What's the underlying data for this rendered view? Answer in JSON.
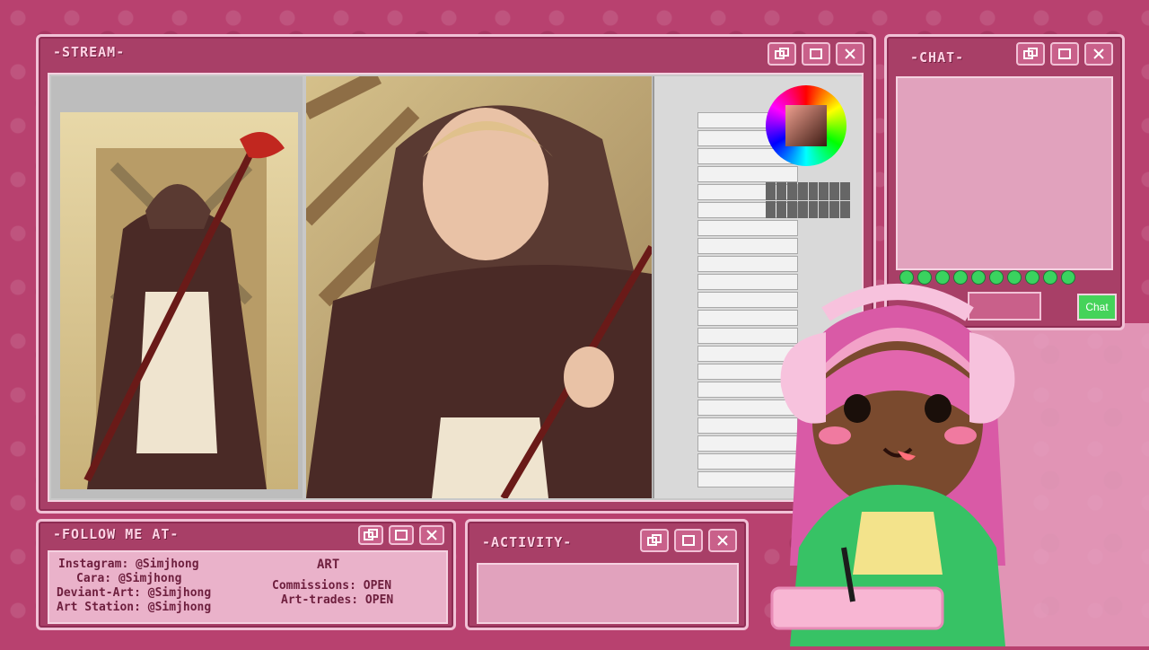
{
  "stream_window": {
    "title": "-STREAM-"
  },
  "chat_window": {
    "title": "-CHAT-",
    "send_label": "Chat"
  },
  "follow_window": {
    "title": "-FOLLOW ME AT-",
    "art_heading": "ART",
    "socials": [
      "Instagram: @Simjhong",
      "Cara: @Simjhong",
      "Deviant-Art: @Simjhong",
      "Art Station: @Simjhong"
    ],
    "commissions_status": "Commissions: OPEN",
    "art_trades_status": "Art-trades: OPEN"
  },
  "activity_window": {
    "title": "-ACTIVITY-"
  },
  "colors": {
    "frame_pink": "#b8416f",
    "window_border": "#f1c1d6",
    "chat_button": "#45d35a"
  }
}
